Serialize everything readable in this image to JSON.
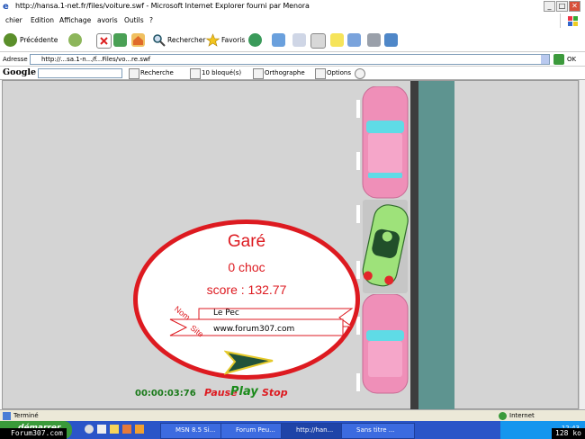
{
  "window": {
    "title": "http://hansa.1-net.fr/files/voiture.swf - Microsoft Internet Explorer fourni par Menora",
    "min": "_",
    "max": "□",
    "close": "✕"
  },
  "menu": {
    "items": [
      "chier",
      "Edition",
      "Affichage",
      "avoris",
      "Outils",
      "?"
    ]
  },
  "toolbar": {
    "back_label": "Précédente",
    "search_label": "Rechercher",
    "favorites_label": "Favoris"
  },
  "address": {
    "label": "Adresse",
    "url": "http://...sa.1-n.../f...Files/vo...re.swf",
    "go_label": "OK"
  },
  "google": {
    "logo": "Google -",
    "search_btn": "Recherche",
    "blocked": "10 bloqué(s)",
    "spell": "Orthographe",
    "options": "Options"
  },
  "game": {
    "status": "Garé",
    "choc": "0 choc",
    "score_label": "score : 132.77",
    "nom_label": "Nom",
    "nom_value": "Le Pec",
    "site_label": "Site",
    "site_value": "www.forum307.com",
    "timer": "00:00:03:76",
    "pause_label": "Pause",
    "play_label": "Play",
    "stop_label": "Stop",
    "colors": {
      "red": "#dd1a20",
      "car_pink": "#ef8fb8",
      "car_green": "#9ee27a",
      "arrow_dark": "#21523a",
      "arrow_yellow": "#e5c92a"
    }
  },
  "statusbar": {
    "text": "Terminé",
    "zone": "Internet"
  },
  "taskbar": {
    "start": "démarrer",
    "tasks": [
      "MSN 8.5 Si...",
      "Forum Peu...",
      "http://han...",
      "Sans titre ..."
    ],
    "clock": "12:43"
  },
  "overlay": {
    "forum": "Forum307.com",
    "rate": "128 ko"
  }
}
